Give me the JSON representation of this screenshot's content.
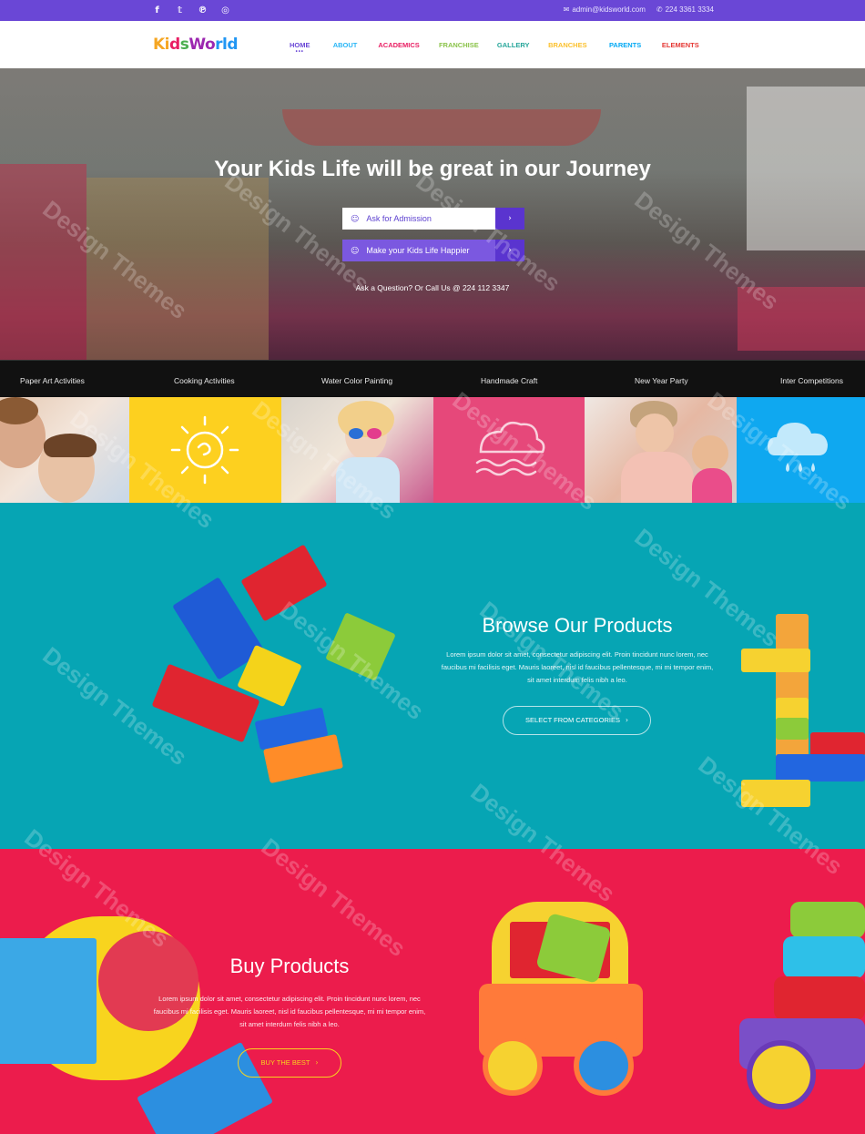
{
  "topbar": {
    "social": [
      "f",
      "t",
      "p",
      "ig"
    ],
    "email": "admin@kidsworld.com",
    "phone": "224 3361 3334"
  },
  "nav": {
    "logo": {
      "part1": "Ki",
      "part2": "d",
      "part3": "s",
      "part4": "Wo",
      "part5": "rld"
    },
    "items": [
      {
        "label": "HOME",
        "color": "#6a47d6"
      },
      {
        "label": "ABOUT",
        "color": "#29b6f6"
      },
      {
        "label": "ACADEMICS",
        "color": "#e91e63"
      },
      {
        "label": "FRANCHISE",
        "color": "#8bc34a"
      },
      {
        "label": "GALLERY",
        "color": "#26a69a"
      },
      {
        "label": "BRANCHES",
        "color": "#fbc02d"
      },
      {
        "label": "PARENTS",
        "color": "#03a9f4"
      },
      {
        "label": "ELEMENTS",
        "color": "#e53935"
      }
    ]
  },
  "hero": {
    "title": "Your Kids Life will be great in our Journey",
    "btn_admission": "Ask for Admission",
    "btn_happier": "Make your Kids Life Happier",
    "call": "Ask a Question? Or Call Us @ 224 112 3347"
  },
  "activities": [
    "Paper Art Activities",
    "Cooking Activities",
    "Water Color Painting",
    "Handmade Craft",
    "New Year Party",
    "Inter Competitions"
  ],
  "browse": {
    "title": "Browse Our Products",
    "text": "Lorem ipsum dolor sit amet, consectetur adipiscing elit. Proin tincidunt nunc lorem, nec faucibus mi facilisis eget. Mauris laoreet, nisl id faucibus pellentesque, mi mi tempor enim, sit amet interdum felis nibh a leo.",
    "button": "SELECT FROM CATEGORIES"
  },
  "buy": {
    "title": "Buy Products",
    "text": "Lorem ipsum dolor sit amet, consectetur adipiscing elit. Proin tincidunt nunc lorem, nec faucibus mi facilisis eget. Mauris laoreet, nisl id faucibus pellentesque, mi mi tempor enim, sit amet interdum felis nibh a leo.",
    "button": "BUY THE BEST"
  },
  "watermark": "Design Themes",
  "colors": {
    "purple": "#6a47d6",
    "teal": "#06a5b4",
    "pink": "#ec1c4c",
    "yellow": "#fdd01f",
    "blue": "#0fa8f0"
  }
}
